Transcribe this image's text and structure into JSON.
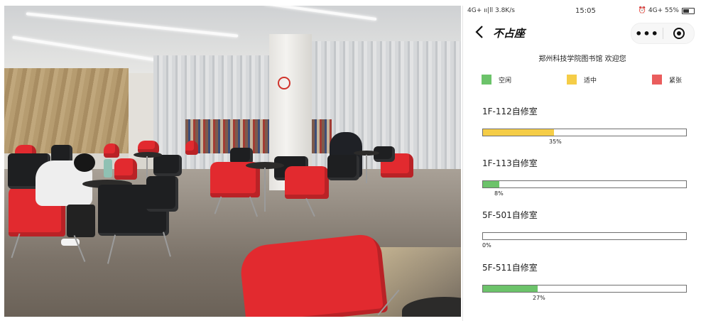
{
  "statusbar": {
    "network": "4G+ ıı|ll 3.8K/s",
    "time": "15:05",
    "right": "⏰ 4G+ 55%"
  },
  "nav": {
    "title": "不占座",
    "more": "•••"
  },
  "welcome": "郑州科技学院图书馆 欢迎您",
  "legend": [
    {
      "label": "空闲",
      "color": "#6cc36a"
    },
    {
      "label": "适中",
      "color": "#f5cd47"
    },
    {
      "label": "紧张",
      "color": "#ea5d5d"
    }
  ],
  "rooms": [
    {
      "name": "1F-112自修室",
      "percent": 35,
      "percent_label": "35%",
      "color": "#f5cd47"
    },
    {
      "name": "1F-113自修室",
      "percent": 8,
      "percent_label": "8%",
      "color": "#6cc36a"
    },
    {
      "name": "5F-501自修室",
      "percent": 0,
      "percent_label": "0%",
      "color": "#6cc36a"
    },
    {
      "name": "5F-511自修室",
      "percent": 27,
      "percent_label": "27%",
      "color": "#6cc36a"
    }
  ]
}
